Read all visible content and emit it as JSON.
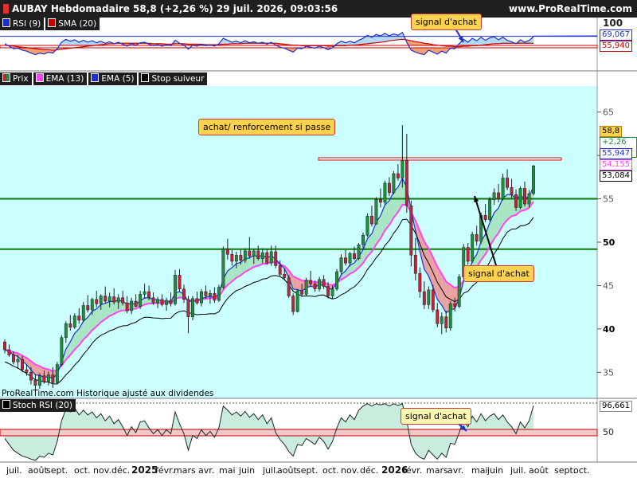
{
  "header": {
    "title": "AUBAY Hebdomadaire 58,8 (+2,26 %) 29 juil. 2026, 09:03:56",
    "site": "www.ProRealTime.com"
  },
  "colors": {
    "bg_price": "#ccffff",
    "candle_up": "#1e8f3c",
    "candle_down": "#c0243a",
    "ema13": "#ff44ff",
    "ema5": "#1f2fcf",
    "stop": "#000000",
    "rsi": "#1f2fcf",
    "sma": "#c80000",
    "hline": "#0a7a0a"
  },
  "rsi_panel": {
    "legend": [
      {
        "label": "RSI (9)",
        "color": "#1f2fcf"
      },
      {
        "label": "SMA (20)",
        "color": "#c80000"
      }
    ],
    "axis_top": "100",
    "rsi_value": "69,067",
    "sma_value": "55,940",
    "callout": "signal d'achat"
  },
  "price_panel": {
    "legend": [
      {
        "label": "Prix",
        "color": "#1e8f3c"
      },
      {
        "label": "EMA (13)",
        "color": "#ff44ff"
      },
      {
        "label": "EMA (5)",
        "color": "#1f2fcf"
      },
      {
        "label": "Stop suiveur",
        "color": "#000000"
      }
    ],
    "callout_top": "achat/ renforcement si passe",
    "callout_bottom": "signal d'achat",
    "last_price": "58,8",
    "change": "+2,26 %",
    "ema5_value": "55,947",
    "ema13_value": "54,155",
    "stop_value": "53,084",
    "copyright": "ProRealTime.com  Historique ajusté aux dividendes"
  },
  "stoch_panel": {
    "legend": [
      {
        "label": "Stoch RSI (20)",
        "color": "#000000"
      }
    ],
    "value": "96,661",
    "level_label": "50",
    "callout": "signal d'achat"
  },
  "chart_data": [
    {
      "type": "candlestick",
      "title": "AUBAY Hebdomadaire",
      "ylim": [
        32,
        68
      ],
      "yticks": [
        35,
        40,
        45,
        50,
        55,
        60,
        65
      ],
      "x_tick_labels": [
        "juil.",
        "août",
        "sept.",
        "oct.",
        "nov.",
        "déc.",
        "2025",
        "févr.",
        "mars",
        "avr.",
        "mai",
        "juin",
        "juil.",
        "août",
        "sept.",
        "oct.",
        "nov.",
        "déc.",
        "2026",
        "févr.",
        "mars",
        "avr.",
        "mai",
        "juin",
        "juil.",
        "août",
        "sept.",
        "oct."
      ],
      "ohlc_weekly": [
        [
          38.5,
          38.8,
          37.2,
          37.6
        ],
        [
          37.6,
          38.2,
          36.8,
          37.0
        ],
        [
          37.0,
          37.4,
          35.9,
          36.2
        ],
        [
          36.2,
          37.0,
          35.4,
          36.5
        ],
        [
          36.5,
          36.9,
          35.0,
          35.3
        ],
        [
          35.3,
          35.9,
          34.6,
          35.0
        ],
        [
          35.0,
          35.6,
          33.6,
          34.1
        ],
        [
          34.1,
          34.8,
          32.8,
          33.5
        ],
        [
          33.5,
          34.9,
          33.1,
          34.6
        ],
        [
          34.6,
          35.2,
          33.7,
          33.9
        ],
        [
          33.9,
          35.1,
          33.5,
          34.7
        ],
        [
          34.7,
          35.6,
          33.2,
          33.8
        ],
        [
          33.8,
          36.2,
          33.6,
          35.9
        ],
        [
          35.9,
          39.3,
          35.7,
          39.0
        ],
        [
          39.0,
          40.9,
          38.4,
          40.6
        ],
        [
          40.6,
          41.6,
          39.8,
          40.2
        ],
        [
          40.2,
          41.8,
          40.0,
          41.5
        ],
        [
          41.5,
          42.4,
          40.6,
          41.0
        ],
        [
          41.0,
          43.1,
          40.8,
          42.7
        ],
        [
          42.7,
          43.9,
          41.9,
          42.2
        ],
        [
          42.2,
          43.6,
          41.6,
          43.4
        ],
        [
          43.4,
          44.4,
          42.5,
          42.9
        ],
        [
          42.9,
          44.0,
          42.2,
          43.8
        ],
        [
          43.8,
          44.9,
          42.9,
          43.2
        ],
        [
          43.2,
          44.2,
          42.5,
          43.7
        ],
        [
          43.7,
          44.7,
          42.8,
          43.1
        ],
        [
          43.1,
          44.0,
          42.3,
          43.6
        ],
        [
          43.6,
          44.4,
          42.7,
          43.0
        ],
        [
          43.0,
          43.8,
          41.8,
          42.1
        ],
        [
          42.1,
          43.6,
          41.7,
          43.2
        ],
        [
          43.2,
          44.0,
          42.5,
          42.6
        ],
        [
          42.6,
          44.4,
          42.3,
          44.0
        ],
        [
          44.0,
          45.2,
          43.5,
          44.3
        ],
        [
          44.3,
          45.0,
          43.3,
          43.6
        ],
        [
          43.6,
          44.2,
          42.8,
          43.0
        ],
        [
          43.0,
          43.7,
          42.4,
          43.4
        ],
        [
          43.4,
          44.0,
          42.6,
          42.8
        ],
        [
          42.8,
          43.6,
          42.1,
          43.3
        ],
        [
          43.3,
          44.2,
          42.6,
          42.9
        ],
        [
          42.9,
          46.8,
          42.7,
          46.2
        ],
        [
          46.2,
          46.9,
          44.3,
          44.6
        ],
        [
          44.6,
          45.1,
          43.0,
          43.4
        ],
        [
          43.4,
          43.8,
          39.5,
          41.4
        ],
        [
          41.4,
          43.8,
          41.0,
          43.5
        ],
        [
          43.5,
          44.3,
          42.8,
          43.0
        ],
        [
          43.0,
          44.6,
          42.6,
          44.3
        ],
        [
          44.3,
          45.0,
          43.5,
          43.8
        ],
        [
          43.8,
          44.5,
          42.9,
          44.1
        ],
        [
          44.1,
          44.8,
          43.0,
          43.3
        ],
        [
          43.3,
          45.1,
          43.1,
          44.8
        ],
        [
          44.8,
          49.5,
          44.6,
          49.2
        ],
        [
          49.2,
          50.4,
          48.0,
          48.6
        ],
        [
          48.6,
          49.1,
          47.3,
          47.8
        ],
        [
          47.8,
          48.9,
          47.0,
          48.5
        ],
        [
          48.5,
          49.1,
          47.4,
          47.9
        ],
        [
          47.9,
          49.3,
          47.6,
          49.0
        ],
        [
          49.0,
          50.6,
          48.1,
          48.4
        ],
        [
          48.4,
          49.2,
          47.5,
          49.0
        ],
        [
          49.0,
          49.6,
          47.9,
          48.1
        ],
        [
          48.1,
          49.3,
          47.6,
          48.8
        ],
        [
          48.8,
          49.2,
          47.4,
          47.6
        ],
        [
          47.6,
          49.6,
          47.3,
          48.9
        ],
        [
          48.9,
          49.6,
          47.0,
          47.3
        ],
        [
          47.3,
          47.9,
          46.0,
          46.3
        ],
        [
          46.3,
          47.0,
          45.6,
          45.9
        ],
        [
          45.9,
          46.2,
          43.6,
          43.8
        ],
        [
          43.8,
          44.1,
          41.6,
          42.0
        ],
        [
          42.0,
          44.6,
          41.9,
          44.4
        ],
        [
          44.4,
          45.2,
          43.7,
          44.0
        ],
        [
          44.0,
          45.9,
          43.8,
          45.6
        ],
        [
          45.6,
          46.7,
          44.9,
          45.2
        ],
        [
          45.2,
          45.6,
          44.3,
          44.6
        ],
        [
          44.6,
          46.0,
          44.3,
          45.7
        ],
        [
          45.7,
          46.2,
          44.6,
          44.9
        ],
        [
          44.9,
          45.4,
          43.5,
          43.8
        ],
        [
          43.8,
          45.0,
          43.4,
          44.6
        ],
        [
          44.6,
          46.9,
          44.4,
          46.6
        ],
        [
          46.6,
          48.6,
          46.3,
          48.2
        ],
        [
          48.2,
          49.1,
          47.3,
          47.6
        ],
        [
          47.6,
          48.9,
          47.2,
          48.7
        ],
        [
          48.7,
          49.5,
          47.9,
          48.1
        ],
        [
          48.1,
          49.9,
          47.9,
          49.7
        ],
        [
          49.7,
          51.1,
          49.3,
          50.8
        ],
        [
          50.8,
          53.3,
          50.6,
          53.0
        ],
        [
          53.0,
          54.2,
          51.8,
          52.1
        ],
        [
          52.1,
          55.2,
          52.0,
          54.9
        ],
        [
          54.9,
          56.2,
          54.0,
          54.6
        ],
        [
          54.6,
          57.1,
          54.3,
          56.8
        ],
        [
          56.8,
          57.5,
          55.3,
          55.7
        ],
        [
          55.7,
          58.2,
          55.5,
          57.9
        ],
        [
          57.9,
          59.0,
          57.1,
          57.4
        ],
        [
          57.4,
          63.5,
          56.3,
          59.4
        ],
        [
          59.4,
          62.5,
          53.4,
          54.2
        ],
        [
          54.2,
          54.8,
          47.2,
          48.5
        ],
        [
          48.5,
          50.5,
          45.6,
          46.4
        ],
        [
          46.4,
          47.1,
          43.6,
          44.3
        ],
        [
          44.3,
          45.5,
          42.3,
          42.8
        ],
        [
          42.8,
          44.9,
          42.3,
          44.5
        ],
        [
          44.5,
          45.1,
          41.9,
          42.2
        ],
        [
          42.2,
          43.0,
          40.2,
          40.6
        ],
        [
          40.6,
          41.9,
          39.4,
          41.4
        ],
        [
          41.4,
          42.1,
          39.6,
          40.1
        ],
        [
          40.1,
          43.2,
          39.8,
          42.9
        ],
        [
          42.9,
          43.6,
          42.0,
          42.6
        ],
        [
          42.6,
          46.3,
          42.4,
          46.0
        ],
        [
          46.0,
          49.8,
          45.7,
          49.4
        ],
        [
          49.4,
          49.9,
          47.4,
          47.8
        ],
        [
          47.8,
          51.2,
          47.6,
          50.9
        ],
        [
          50.9,
          51.9,
          49.6,
          50.1
        ],
        [
          50.1,
          53.4,
          49.8,
          53.1
        ],
        [
          53.1,
          54.4,
          52.3,
          52.6
        ],
        [
          52.6,
          55.2,
          52.4,
          54.9
        ],
        [
          54.9,
          56.2,
          54.3,
          55.7
        ],
        [
          55.7,
          56.7,
          54.6,
          55.0
        ],
        [
          55.0,
          57.9,
          54.8,
          57.4
        ],
        [
          57.4,
          58.4,
          56.0,
          56.3
        ],
        [
          56.3,
          57.3,
          55.1,
          55.5
        ],
        [
          55.5,
          56.1,
          53.6,
          54.0
        ],
        [
          54.0,
          56.4,
          53.8,
          56.2
        ],
        [
          56.2,
          57.0,
          54.1,
          54.4
        ],
        [
          54.4,
          56.0,
          54.0,
          55.6
        ],
        [
          55.6,
          58.9,
          55.4,
          58.8
        ]
      ],
      "horizontal_lines": [
        55.0,
        49.2
      ],
      "resistance": 59.6
    },
    {
      "type": "line",
      "title": "RSI (9)",
      "ylim": [
        0,
        100
      ],
      "series": [
        {
          "name": "RSI (9)",
          "values": [
            55,
            50,
            45,
            46,
            42,
            40,
            36,
            33,
            36,
            34,
            38,
            36,
            45,
            58,
            64,
            60,
            63,
            58,
            62,
            58,
            61,
            57,
            60,
            56,
            59,
            55,
            58,
            54,
            50,
            55,
            52,
            57,
            58,
            54,
            51,
            53,
            50,
            53,
            51,
            62,
            56,
            52,
            44,
            52,
            50,
            54,
            51,
            53,
            50,
            55,
            66,
            62,
            58,
            60,
            57,
            61,
            57,
            59,
            56,
            58,
            54,
            58,
            52,
            48,
            46,
            42,
            38,
            46,
            45,
            50,
            48,
            46,
            50,
            47,
            43,
            47,
            55,
            60,
            57,
            60,
            57,
            62,
            66,
            72,
            68,
            74,
            71,
            76,
            71,
            75,
            72,
            78,
            58,
            42,
            38,
            35,
            33,
            42,
            38,
            34,
            40,
            36,
            46,
            45,
            55,
            64,
            58,
            66,
            61,
            68,
            62,
            67,
            69,
            63,
            68,
            62,
            59,
            55,
            63,
            58,
            62,
            69
          ]
        },
        {
          "name": "SMA (20)",
          "values": [
            52,
            51,
            50,
            49,
            48,
            47,
            46,
            45,
            44,
            43,
            43,
            42,
            43,
            44,
            45,
            46,
            47,
            48,
            49,
            50,
            51,
            52,
            53,
            54,
            55,
            55,
            56,
            56,
            56,
            56,
            56,
            56,
            56,
            56,
            55,
            55,
            55,
            54,
            54,
            55,
            55,
            55,
            54,
            54,
            54,
            54,
            53,
            53,
            53,
            53,
            54,
            54,
            55,
            55,
            55,
            56,
            56,
            56,
            56,
            56,
            56,
            56,
            56,
            55,
            54,
            53,
            52,
            52,
            51,
            51,
            51,
            51,
            51,
            51,
            50,
            50,
            51,
            51,
            51,
            52,
            52,
            53,
            54,
            55,
            56,
            57,
            58,
            59,
            61,
            62,
            63,
            64,
            63,
            61,
            59,
            58,
            56,
            55,
            53,
            52,
            51,
            50,
            50,
            49,
            49,
            50,
            50,
            51,
            51,
            52,
            53,
            54,
            55,
            55,
            56,
            56,
            56,
            56,
            56,
            56,
            56,
            56
          ]
        }
      ],
      "levels": [
        70,
        50
      ]
    },
    {
      "type": "area",
      "title": "Stoch RSI (20)",
      "ylim": [
        0,
        100
      ],
      "series": [
        {
          "name": "Stoch RSI (20)",
          "values": [
            40,
            30,
            20,
            15,
            10,
            8,
            5,
            3,
            10,
            8,
            15,
            12,
            35,
            70,
            90,
            85,
            92,
            80,
            88,
            80,
            85,
            75,
            82,
            70,
            78,
            65,
            72,
            60,
            45,
            60,
            50,
            68,
            70,
            58,
            48,
            55,
            45,
            55,
            48,
            85,
            65,
            48,
            20,
            45,
            40,
            55,
            45,
            52,
            42,
            58,
            95,
            88,
            80,
            85,
            78,
            86,
            76,
            82,
            72,
            80,
            65,
            75,
            50,
            38,
            30,
            18,
            10,
            30,
            28,
            40,
            35,
            30,
            42,
            35,
            22,
            35,
            58,
            75,
            68,
            80,
            72,
            88,
            95,
            99,
            95,
            99,
            97,
            99,
            95,
            99,
            96,
            99,
            70,
            30,
            15,
            8,
            5,
            20,
            12,
            5,
            15,
            8,
            32,
            30,
            50,
            72,
            60,
            78,
            68,
            82,
            70,
            78,
            82,
            72,
            80,
            68,
            60,
            48,
            68,
            58,
            70,
            96
          ]
        }
      ],
      "levels": [
        50
      ]
    }
  ]
}
